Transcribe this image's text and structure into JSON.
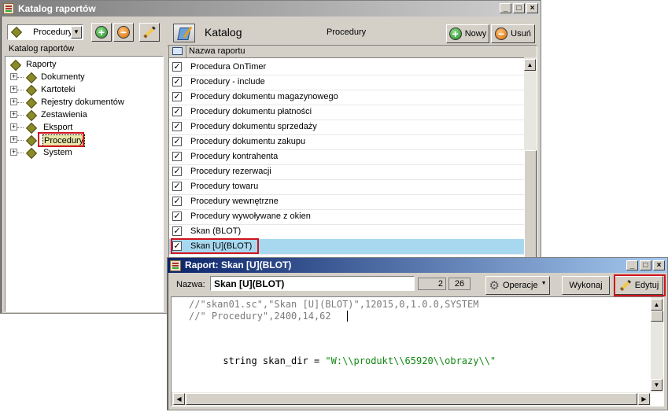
{
  "catalog_window": {
    "title": "Katalog raportów",
    "combo_value": "Procedury",
    "tree_header": "Katalog raportów",
    "tree": [
      {
        "label": "Raporty"
      },
      {
        "label": "Dokumenty"
      },
      {
        "label": "Kartoteki"
      },
      {
        "label": "Rejestry dokumentów"
      },
      {
        "label": "Zestawienia"
      },
      {
        "label": "Eksport"
      },
      {
        "label": "Procedury"
      },
      {
        "label": "System"
      }
    ],
    "right_header_title": "Katalog",
    "right_header_sub": "Procedury",
    "new_button": "Nowy",
    "delete_button": "Usuń",
    "column_header": "Nazwa raportu",
    "rows": [
      "Procedura OnTimer",
      "Procedury - include",
      "Procedury dokumentu magazynowego",
      "Procedury dokumentu płatności",
      "Procedury dokumentu sprzedaży",
      "Procedury dokumentu zakupu",
      "Procedury kontrahenta",
      "Procedury rezerwacji",
      "Procedury towaru",
      "Procedury wewnętrzne",
      "Procedury wywoływane z okien",
      "Skan (BLOT)",
      "Skan [U](BLOT)"
    ]
  },
  "report_window": {
    "title": "Raport: Skan [U](BLOT)",
    "name_label": "Nazwa:",
    "name_value": "Skan [U](BLOT)",
    "line_num": "2",
    "col_num": "26",
    "operations_button": "Operacje",
    "execute_button": "Wykonaj",
    "edit_button": "Edytuj",
    "code_lines": [
      "//\"skan01.sc\",\"Skan [U](BLOT)\",12015,0,1.0.0,SYSTEM",
      "//\" Procedury\",2400,14,62",
      "",
      "",
      "string skan_dir = \"W:\\\\produkt\\\\65920\\\\obrazy\\\\\""
    ]
  },
  "colors": {
    "highlight": "#e8e6a8",
    "selected_row": "#a8d8f0",
    "annotation_red": "#d0141d",
    "code_string_green": "#118811"
  }
}
